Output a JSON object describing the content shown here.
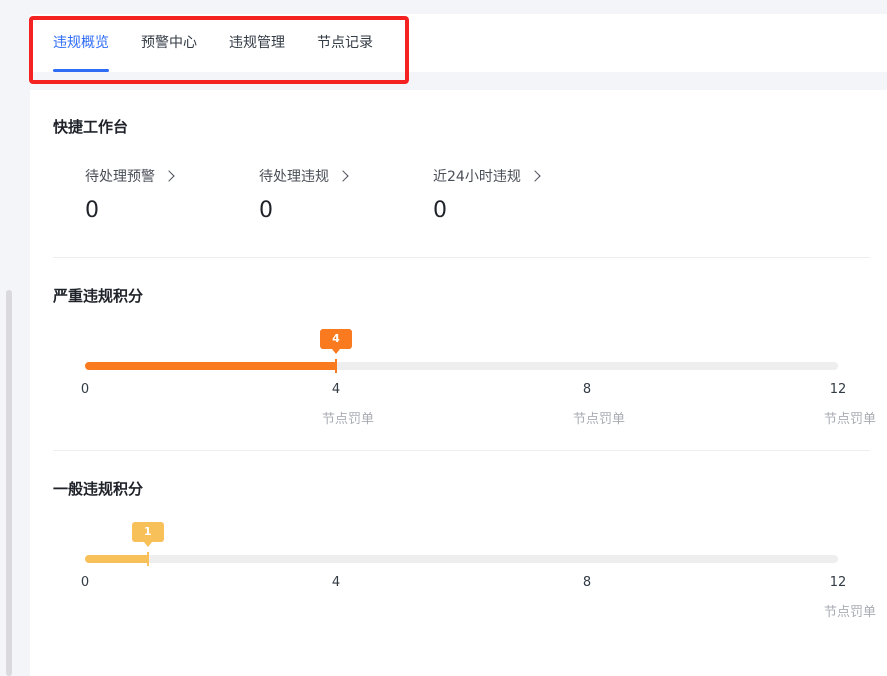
{
  "tabs": [
    {
      "label": "违规概览",
      "active": true
    },
    {
      "label": "预警中心",
      "active": false
    },
    {
      "label": "违规管理",
      "active": false
    },
    {
      "label": "节点记录",
      "active": false
    }
  ],
  "quick": {
    "title": "快捷工作台",
    "items": [
      {
        "label": "待处理预警",
        "value": "0"
      },
      {
        "label": "待处理违规",
        "value": "0"
      },
      {
        "label": "近24小时违规",
        "value": "0"
      }
    ]
  },
  "severe": {
    "title": "严重违规积分",
    "value": 4,
    "marker": "4",
    "max": 12,
    "color": "#f97a1f",
    "ticks": [
      "0",
      "4",
      "8",
      "12"
    ],
    "captions": [
      "",
      "节点罚单",
      "节点罚单",
      "节点罚单"
    ]
  },
  "general": {
    "title": "一般违规积分",
    "value": 1,
    "marker": "1",
    "max": 12,
    "color": "#f8c058",
    "ticks": [
      "0",
      "4",
      "8",
      "12"
    ],
    "captions": [
      "",
      "",
      "",
      "节点罚单"
    ]
  },
  "colors": {
    "accent": "#2f6cf6",
    "highlight": "#f52222"
  }
}
